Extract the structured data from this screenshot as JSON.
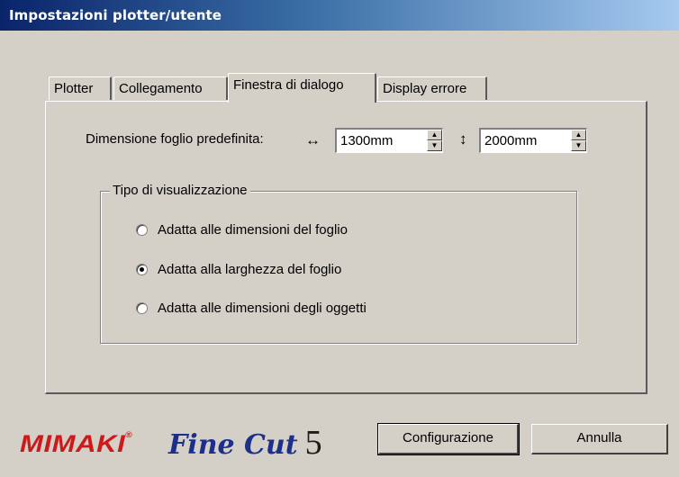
{
  "window": {
    "title": "Impostazioni plotter/utente"
  },
  "tabs": [
    {
      "label": "Plotter",
      "active": false
    },
    {
      "label": "Collegamento",
      "active": false
    },
    {
      "label": "Finestra di dialogo",
      "active": true
    },
    {
      "label": "Display errore",
      "active": false
    }
  ],
  "sheet_size": {
    "label": "Dimensione foglio predefinita:",
    "width_arrow": "↔",
    "width_value": "1300mm",
    "height_arrow": "↕",
    "height_value": "2000mm"
  },
  "display_type": {
    "legend": "Tipo di visualizzazione",
    "options": [
      {
        "label": "Adatta alle dimensioni del foglio",
        "selected": false
      },
      {
        "label": "Adatta alla larghezza del foglio",
        "selected": true
      },
      {
        "label": "Adatta alle dimensioni degli oggetti",
        "selected": false
      }
    ]
  },
  "branding": {
    "mimaki": "MIMAKI",
    "mimaki_mark": "®",
    "product": "Fine Cut",
    "version": "5"
  },
  "buttons": {
    "configure": "Configurazione",
    "cancel": "Annulla"
  },
  "colors": {
    "titlebar_start": "#0a246a",
    "titlebar_end": "#a6caf0",
    "mimaki_red": "#cc1a1a",
    "finecut_blue": "#1c2f8a",
    "dialog_bg": "#d4d0c8"
  }
}
